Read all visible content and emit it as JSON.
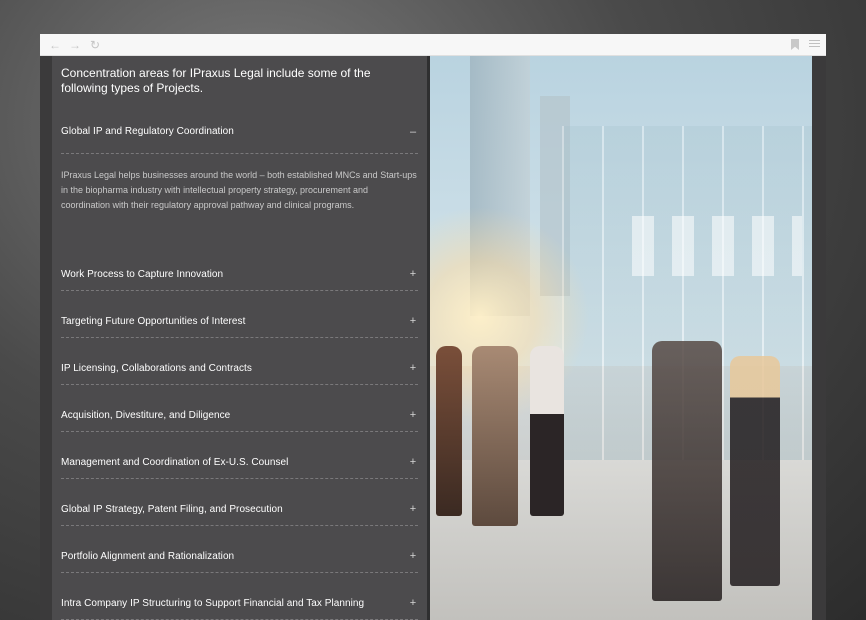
{
  "browser": {
    "back_icon": "back-arrow-icon",
    "forward_icon": "forward-arrow-icon",
    "reload_icon": "reload-icon",
    "bookmark_icon": "bookmark-icon",
    "menu_icon": "menu-icon"
  },
  "intro": "Concentration areas for IPraxus Legal include some of the following types of Projects.",
  "accordion": [
    {
      "title": "Global IP and Regulatory Coordination",
      "toggle": "–",
      "open": true,
      "body": "IPraxus Legal helps businesses around the world – both established MNCs and Start-ups in the biopharma industry with intellectual property strategy, procurement and coordination with their regulatory approval pathway and clinical programs."
    },
    {
      "title": "Work Process to Capture Innovation",
      "toggle": "+"
    },
    {
      "title": "Targeting Future Opportunities of Interest",
      "toggle": "+"
    },
    {
      "title": "IP Licensing, Collaborations and Contracts",
      "toggle": "+"
    },
    {
      "title": "Acquisition, Divestiture, and Diligence",
      "toggle": "+"
    },
    {
      "title": "Management and Coordination of Ex-U.S. Counsel",
      "toggle": "+"
    },
    {
      "title": "Global IP Strategy, Patent Filing, and Prosecution",
      "toggle": "+"
    },
    {
      "title": "Portfolio Alignment and Rationalization",
      "toggle": "+"
    },
    {
      "title": "Intra Company IP Structuring to Support Financial and Tax Planning",
      "toggle": "+"
    }
  ],
  "colors": {
    "panel_bg": "#4c4b4d",
    "text": "#ffffff",
    "body_text": "#c9c9c9"
  }
}
